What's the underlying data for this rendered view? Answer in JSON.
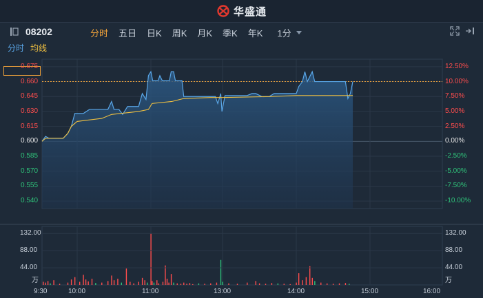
{
  "header": {
    "brand": "华盛通"
  },
  "toolbar": {
    "stock_code": "08202",
    "tabs": [
      "分时",
      "五日",
      "日K",
      "周K",
      "月K",
      "季K",
      "年K"
    ],
    "active_tab": "分时",
    "period": "1分"
  },
  "legend": {
    "fenshi": "分时",
    "junxian": "均线"
  },
  "colors": {
    "up": "#ff4d4d",
    "down": "#2fc37a",
    "flat": "#e6e6e6",
    "accent": "#f0a23a",
    "price_line": "#5aa7e8",
    "avg_line": "#f0c040"
  },
  "icons": {
    "panel": "panel-toggle-icon",
    "fullscreen": "fullscreen-icon",
    "expand": "expand-icon"
  },
  "chart_data": {
    "type": "line",
    "prev_close": 0.6,
    "current_price_label": "0.660",
    "current_pct_label": "10.00%",
    "price_ticks": [
      "0.675",
      "0.660",
      "0.645",
      "0.630",
      "0.615",
      "0.600",
      "0.585",
      "0.570",
      "0.555",
      "0.540"
    ],
    "pct_ticks": [
      "12.50%",
      "10.00%",
      "7.50%",
      "5.00%",
      "2.50%",
      "0.00%",
      "-2.50%",
      "-5.00%",
      "-7.50%",
      "-10.00%"
    ],
    "price_ylim": [
      0.5325,
      0.6825
    ],
    "volume_ticks": [
      "132.00",
      "88.00",
      "44.00"
    ],
    "volume_unit": "万",
    "volume_ylim": [
      0,
      150
    ],
    "x_ticks": [
      "9:30",
      "10:00",
      "11:00",
      "13:00",
      "14:00",
      "15:00",
      "16:00"
    ],
    "series": [
      {
        "name": "分时",
        "points": [
          [
            "9:30",
            0.6
          ],
          [
            "9:33",
            0.605
          ],
          [
            "9:36",
            0.603
          ],
          [
            "9:48",
            0.603
          ],
          [
            "9:52",
            0.608
          ],
          [
            "9:55",
            0.615
          ],
          [
            "9:58",
            0.628
          ],
          [
            "10:05",
            0.628
          ],
          [
            "10:10",
            0.632
          ],
          [
            "10:25",
            0.632
          ],
          [
            "10:28",
            0.64
          ],
          [
            "10:30",
            0.632
          ],
          [
            "10:34",
            0.632
          ],
          [
            "10:37",
            0.627
          ],
          [
            "10:41",
            0.635
          ],
          [
            "10:50",
            0.635
          ],
          [
            "10:53",
            0.648
          ],
          [
            "10:56",
            0.642
          ],
          [
            "10:58",
            0.666
          ],
          [
            "11:00",
            0.67
          ],
          [
            "11:03",
            0.661
          ],
          [
            "11:12",
            0.661
          ],
          [
            "11:15",
            0.666
          ],
          [
            "11:19",
            0.661
          ],
          [
            "11:31",
            0.661
          ],
          [
            "11:34",
            0.67
          ],
          [
            "11:38",
            0.67
          ],
          [
            "11:41",
            0.661
          ],
          [
            "11:52",
            0.661
          ],
          [
            "11:55",
            0.645
          ],
          [
            "12:40",
            0.645
          ],
          [
            "12:48",
            0.645
          ],
          [
            "12:52",
            0.638
          ],
          [
            "12:57",
            0.648
          ],
          [
            "12:59",
            0.63
          ],
          [
            "13:02",
            0.646
          ],
          [
            "13:20",
            0.646
          ],
          [
            "13:24",
            0.648
          ],
          [
            "13:27",
            0.648
          ],
          [
            "13:32",
            0.645
          ],
          [
            "13:38",
            0.645
          ],
          [
            "13:42",
            0.648
          ],
          [
            "13:48",
            0.648
          ],
          [
            "13:55",
            0.648
          ],
          [
            "14:00",
            0.648
          ],
          [
            "14:02",
            0.655
          ],
          [
            "14:05",
            0.66
          ],
          [
            "14:07",
            0.67
          ],
          [
            "14:09",
            0.66
          ],
          [
            "14:11",
            0.665
          ],
          [
            "14:13",
            0.67
          ],
          [
            "14:15",
            0.66
          ],
          [
            "14:20",
            0.66
          ],
          [
            "14:25",
            0.66
          ],
          [
            "14:40",
            0.66
          ],
          [
            "14:42",
            0.643
          ],
          [
            "14:44",
            0.648
          ],
          [
            "14:46",
            0.66
          ]
        ]
      },
      {
        "name": "均线",
        "points": [
          [
            "9:30",
            0.6
          ],
          [
            "9:33",
            0.603
          ],
          [
            "9:48",
            0.603
          ],
          [
            "9:52",
            0.608
          ],
          [
            "9:55",
            0.615
          ],
          [
            "10:00",
            0.62
          ],
          [
            "10:20",
            0.623
          ],
          [
            "10:28",
            0.627
          ],
          [
            "10:50",
            0.63
          ],
          [
            "10:58",
            0.632
          ],
          [
            "11:02",
            0.638
          ],
          [
            "11:35",
            0.64
          ],
          [
            "11:55",
            0.643
          ],
          [
            "12:40",
            0.644
          ],
          [
            "13:00",
            0.644
          ],
          [
            "13:40",
            0.645
          ],
          [
            "14:00",
            0.646
          ],
          [
            "14:46",
            0.646
          ]
        ]
      }
    ],
    "volume": [
      {
        "t": "9:31",
        "v": 8,
        "c": "up"
      },
      {
        "t": "9:33",
        "v": 6,
        "c": "up"
      },
      {
        "t": "9:35",
        "v": 10,
        "c": "up"
      },
      {
        "t": "9:37",
        "v": 4,
        "c": "down"
      },
      {
        "t": "9:40",
        "v": 12,
        "c": "up"
      },
      {
        "t": "9:45",
        "v": 3,
        "c": "up"
      },
      {
        "t": "9:52",
        "v": 6,
        "c": "up"
      },
      {
        "t": "9:55",
        "v": 14,
        "c": "up"
      },
      {
        "t": "9:58",
        "v": 20,
        "c": "up"
      },
      {
        "t": "10:02",
        "v": 8,
        "c": "up"
      },
      {
        "t": "10:05",
        "v": 26,
        "c": "up"
      },
      {
        "t": "10:07",
        "v": 14,
        "c": "up"
      },
      {
        "t": "10:09",
        "v": 9,
        "c": "up"
      },
      {
        "t": "10:12",
        "v": 16,
        "c": "up"
      },
      {
        "t": "10:15",
        "v": 5,
        "c": "down"
      },
      {
        "t": "10:20",
        "v": 6,
        "c": "up"
      },
      {
        "t": "10:25",
        "v": 10,
        "c": "up"
      },
      {
        "t": "10:28",
        "v": 24,
        "c": "up"
      },
      {
        "t": "10:30",
        "v": 12,
        "c": "up"
      },
      {
        "t": "10:33",
        "v": 16,
        "c": "up"
      },
      {
        "t": "10:36",
        "v": 6,
        "c": "down"
      },
      {
        "t": "10:40",
        "v": 42,
        "c": "up"
      },
      {
        "t": "10:43",
        "v": 8,
        "c": "up"
      },
      {
        "t": "10:46",
        "v": 4,
        "c": "up"
      },
      {
        "t": "10:50",
        "v": 8,
        "c": "up"
      },
      {
        "t": "10:53",
        "v": 18,
        "c": "up"
      },
      {
        "t": "10:55",
        "v": 12,
        "c": "up"
      },
      {
        "t": "10:57",
        "v": 6,
        "c": "down"
      },
      {
        "t": "11:00",
        "v": 132,
        "c": "up"
      },
      {
        "t": "11:02",
        "v": 10,
        "c": "up"
      },
      {
        "t": "11:05",
        "v": 6,
        "c": "down"
      },
      {
        "t": "11:10",
        "v": 12,
        "c": "up"
      },
      {
        "t": "11:13",
        "v": 4,
        "c": "up"
      },
      {
        "t": "11:20",
        "v": 8,
        "c": "up"
      },
      {
        "t": "11:24",
        "v": 50,
        "c": "up"
      },
      {
        "t": "11:27",
        "v": 16,
        "c": "up"
      },
      {
        "t": "11:30",
        "v": 6,
        "c": "up"
      },
      {
        "t": "11:34",
        "v": 28,
        "c": "up"
      },
      {
        "t": "11:38",
        "v": 6,
        "c": "down"
      },
      {
        "t": "11:44",
        "v": 4,
        "c": "up"
      },
      {
        "t": "11:50",
        "v": 3,
        "c": "up"
      },
      {
        "t": "11:55",
        "v": 6,
        "c": "up"
      },
      {
        "t": "12:00",
        "v": 3,
        "c": "up"
      },
      {
        "t": "12:05",
        "v": 5,
        "c": "up"
      },
      {
        "t": "12:10",
        "v": 2,
        "c": "up"
      },
      {
        "t": "12:20",
        "v": 4,
        "c": "down"
      },
      {
        "t": "12:30",
        "v": 3,
        "c": "up"
      },
      {
        "t": "12:40",
        "v": 4,
        "c": "up"
      },
      {
        "t": "12:50",
        "v": 6,
        "c": "up"
      },
      {
        "t": "12:57",
        "v": 64,
        "c": "down"
      },
      {
        "t": "13:00",
        "v": 8,
        "c": "down"
      },
      {
        "t": "13:05",
        "v": 4,
        "c": "up"
      },
      {
        "t": "13:12",
        "v": 3,
        "c": "up"
      },
      {
        "t": "13:20",
        "v": 6,
        "c": "up"
      },
      {
        "t": "13:27",
        "v": 10,
        "c": "up"
      },
      {
        "t": "13:30",
        "v": 4,
        "c": "up"
      },
      {
        "t": "13:35",
        "v": 3,
        "c": "up"
      },
      {
        "t": "13:40",
        "v": 5,
        "c": "up"
      },
      {
        "t": "13:45",
        "v": 4,
        "c": "down"
      },
      {
        "t": "13:50",
        "v": 3,
        "c": "up"
      },
      {
        "t": "13:55",
        "v": 2,
        "c": "up"
      },
      {
        "t": "14:00",
        "v": 6,
        "c": "up"
      },
      {
        "t": "14:02",
        "v": 30,
        "c": "up"
      },
      {
        "t": "14:05",
        "v": 12,
        "c": "up"
      },
      {
        "t": "14:08",
        "v": 20,
        "c": "up"
      },
      {
        "t": "14:11",
        "v": 48,
        "c": "up"
      },
      {
        "t": "14:13",
        "v": 18,
        "c": "up"
      },
      {
        "t": "14:15",
        "v": 10,
        "c": "down"
      },
      {
        "t": "14:20",
        "v": 6,
        "c": "up"
      },
      {
        "t": "14:25",
        "v": 4,
        "c": "up"
      },
      {
        "t": "14:30",
        "v": 3,
        "c": "up"
      },
      {
        "t": "14:35",
        "v": 4,
        "c": "up"
      },
      {
        "t": "14:40",
        "v": 5,
        "c": "up"
      },
      {
        "t": "14:43",
        "v": 3,
        "c": "down"
      }
    ]
  }
}
